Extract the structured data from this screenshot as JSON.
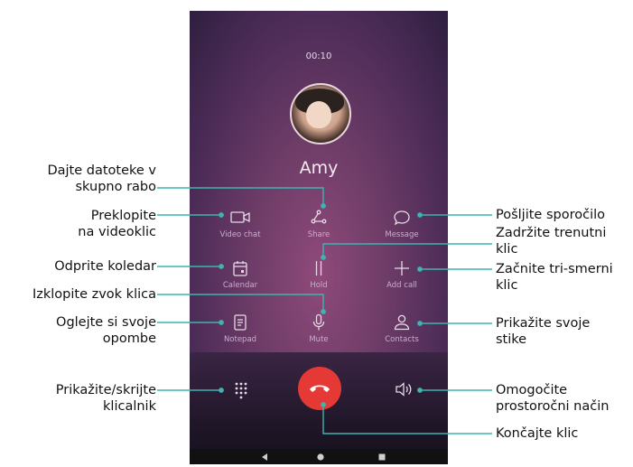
{
  "screen": {
    "timer": "00:10",
    "caller_name": "Amy",
    "controls": {
      "video_chat": "Video chat",
      "share": "Share",
      "message": "Message",
      "calendar": "Calendar",
      "hold": "Hold",
      "add_call": "Add call",
      "notepad": "Notepad",
      "mute": "Mute",
      "contacts": "Contacts"
    }
  },
  "annotations": {
    "share": [
      "Dajte datoteke v",
      "skupno rabo"
    ],
    "video": [
      "Preklopite",
      "na videoklic"
    ],
    "calendar": "Odprite koledar",
    "mute": "Izklopite zvok klica",
    "notepad": [
      "Oglejte si svoje",
      "opombe"
    ],
    "dialpad": [
      "Prikažite/skrijte",
      "klicalnik"
    ],
    "message": "Pošljite sporočilo",
    "hold": [
      "Zadržite trenutni",
      "klic"
    ],
    "add_call": [
      "Začnite tri-smerni",
      "klic"
    ],
    "contacts": [
      "Prikažite svoje",
      "stike"
    ],
    "speaker": [
      "Omogočite",
      "prostoročni način"
    ],
    "end_call": "Končajte klic"
  },
  "colors": {
    "accent_line": "#3fb3b0",
    "end_call": "#e53935"
  },
  "icons": [
    "video-icon",
    "share-icon",
    "message-icon",
    "calendar-icon",
    "hold-icon",
    "add-icon",
    "notepad-icon",
    "mic-icon",
    "contacts-icon",
    "dialpad-icon",
    "end-call-icon",
    "speaker-icon",
    "back-icon",
    "home-icon",
    "recents-icon"
  ]
}
